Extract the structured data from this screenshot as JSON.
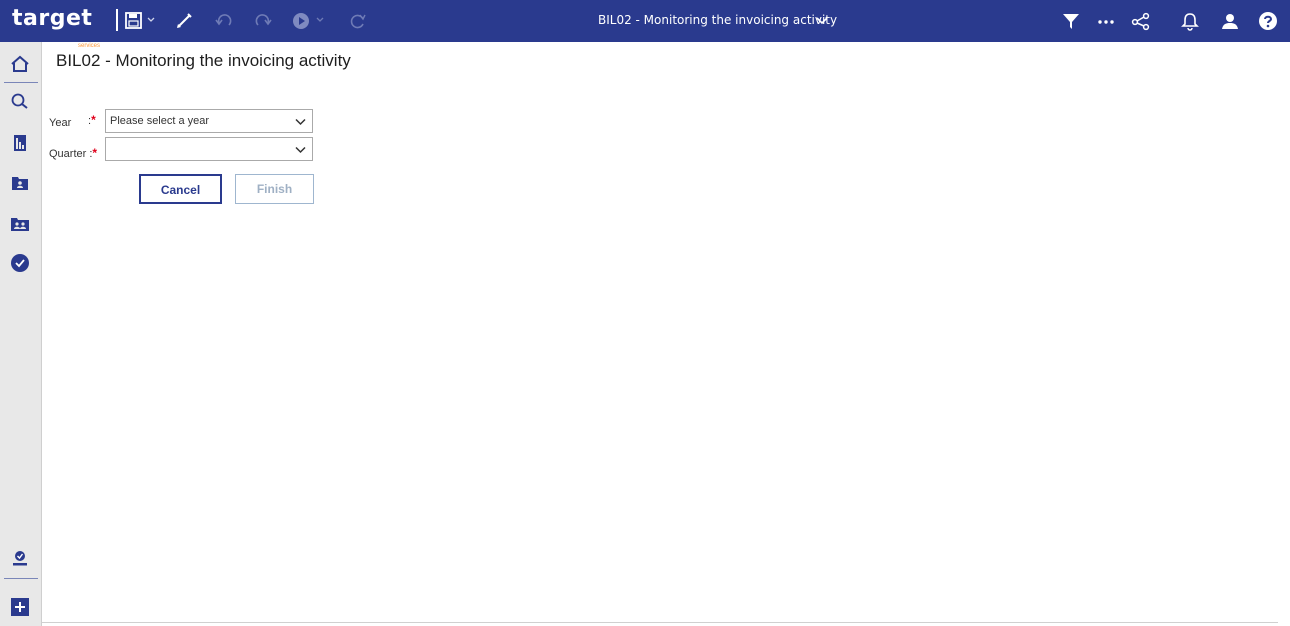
{
  "app": {
    "logo_text": "target",
    "logo_sub": "services",
    "window_title": "BIL02 - Monitoring the invoicing activity"
  },
  "toolbar": {
    "left_icons": [
      "save-icon",
      "edit-icon",
      "undo-icon",
      "redo-icon",
      "run-icon",
      "refresh-icon"
    ],
    "right_icons": [
      "filter-icon",
      "more-icon",
      "share-icon",
      "notification-icon",
      "user-icon",
      "help-icon"
    ]
  },
  "sidebar": {
    "items": [
      "home-icon",
      "search-icon",
      "report-icon",
      "team-folder-icon",
      "shared-folder-icon",
      "status-check-icon"
    ],
    "bottom_items": [
      "my-content-icon",
      "new-icon"
    ]
  },
  "page": {
    "title": "BIL02 - Monitoring the invoicing activity"
  },
  "form": {
    "year_label": "Year",
    "year_sep": ":",
    "year_value": "Please select a year",
    "quarter_label": "Quarter :",
    "quarter_value": "",
    "required_mark": "*"
  },
  "buttons": {
    "cancel": "Cancel",
    "finish": "Finish"
  },
  "colors": {
    "topbar": "#2a3a8e",
    "accent": "#2a3a8e",
    "required": "#e0001b",
    "logo_sub": "#ff9a3c"
  }
}
